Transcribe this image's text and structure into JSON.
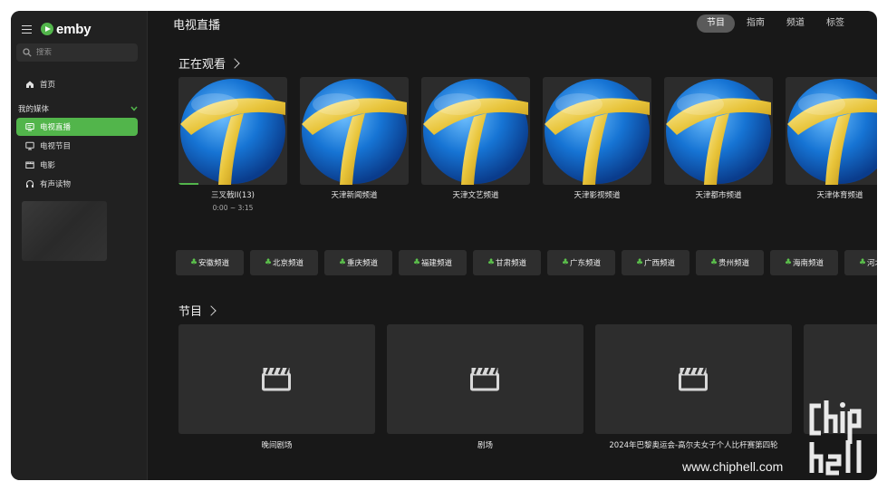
{
  "sidebar": {
    "brand": "emby",
    "search_placeholder": "搜索",
    "home": "首页",
    "section": "我的媒体",
    "items": [
      {
        "label": "电视直播",
        "icon": "tv-icon",
        "active": true
      },
      {
        "label": "电视节目",
        "icon": "monitor-icon",
        "active": false
      },
      {
        "label": "电影",
        "icon": "film-icon",
        "active": false
      },
      {
        "label": "有声读物",
        "icon": "headphones-icon",
        "active": false
      }
    ]
  },
  "header": {
    "title": "电视直播",
    "tabs": [
      "节目",
      "指南",
      "频道",
      "标签"
    ],
    "active_tab": "节目"
  },
  "watching": {
    "title": "正在观看",
    "items": [
      {
        "name": "三叉戟II(13)",
        "time": "0:00 ~ 3:15",
        "progress": 0.18
      },
      {
        "name": "天津新闻频道"
      },
      {
        "name": "天津文艺频道"
      },
      {
        "name": "天津影视频道"
      },
      {
        "name": "天津都市频道"
      },
      {
        "name": "天津体育频道"
      }
    ]
  },
  "tags": [
    "安徽频道",
    "北京频道",
    "重庆频道",
    "福建频道",
    "甘肃频道",
    "广东频道",
    "广西频道",
    "贵州频道",
    "海南频道",
    "河北频道"
  ],
  "programs": {
    "title": "节目",
    "items": [
      {
        "name": "晚间剧场"
      },
      {
        "name": "剧场"
      },
      {
        "name": "2024年巴黎奥运会-高尔夫女子个人比杆赛第四轮"
      },
      {
        "name": ""
      }
    ]
  },
  "watermark": "www.chiphell.com",
  "colors": {
    "accent": "#52b54b",
    "background": "#181818",
    "sidebar": "#212121"
  }
}
